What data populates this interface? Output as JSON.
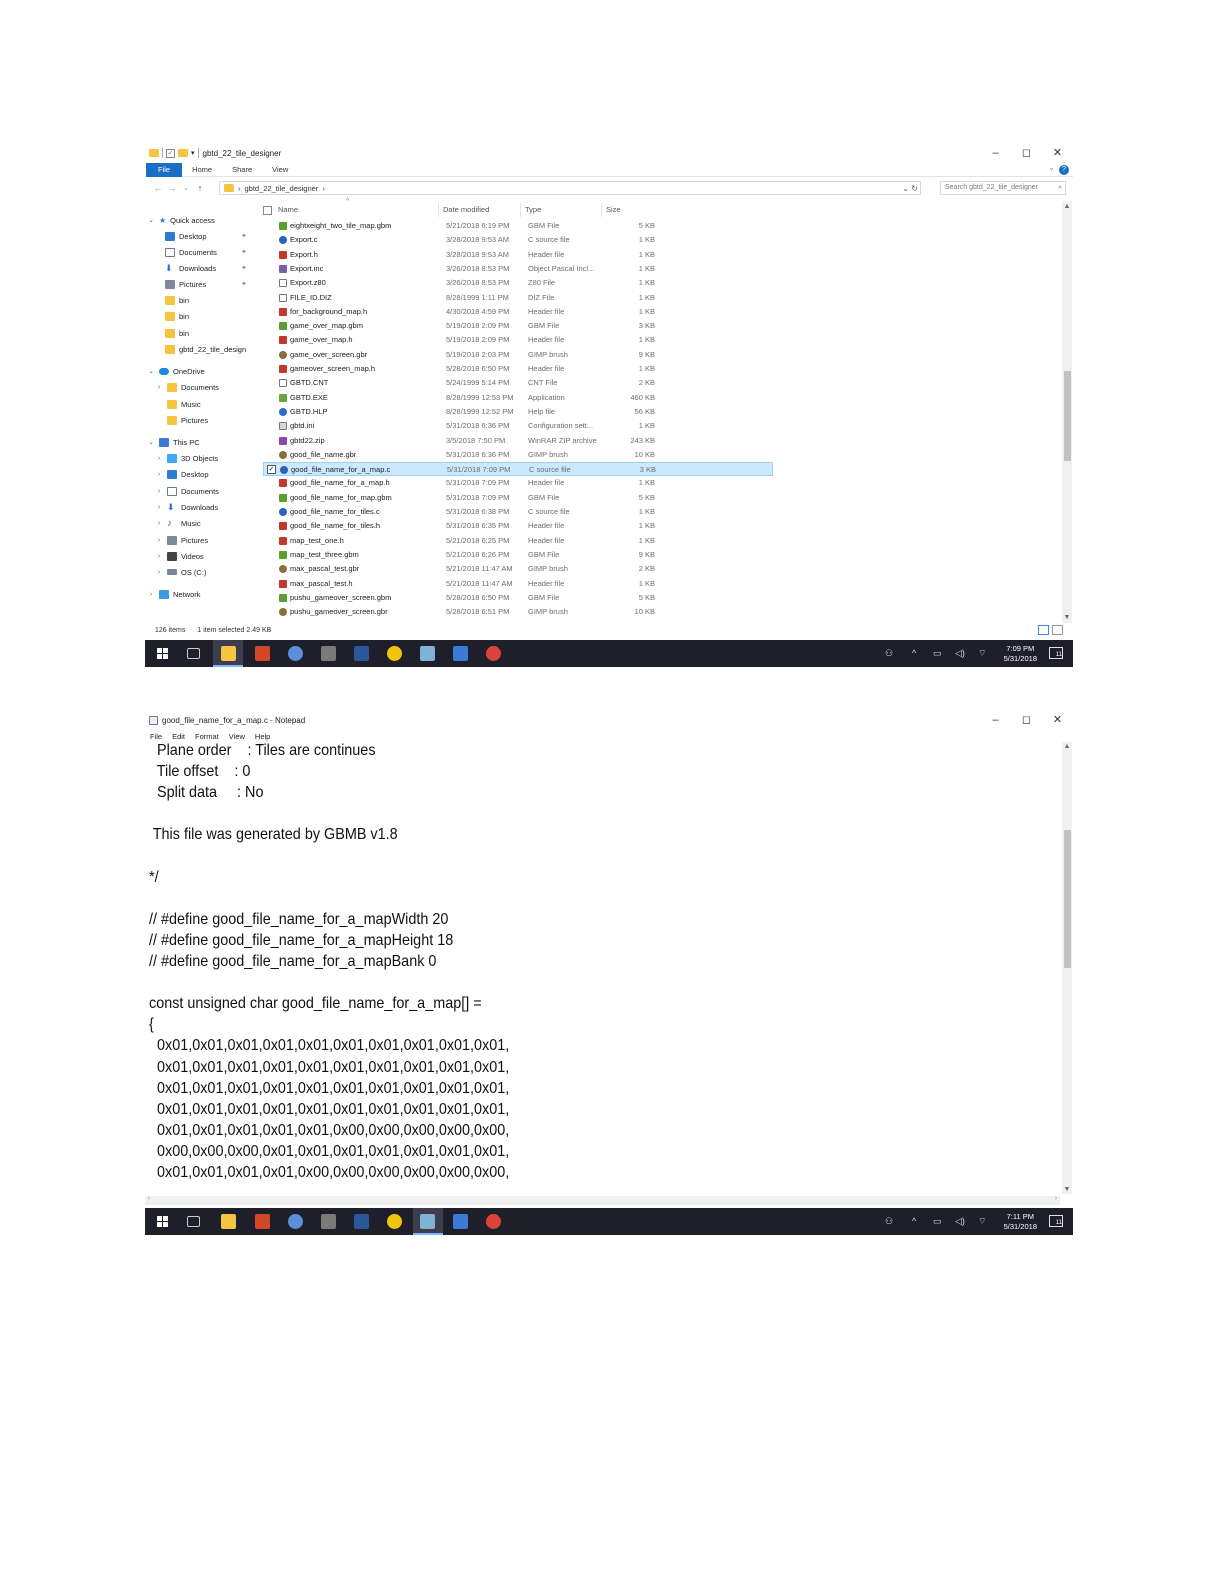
{
  "explorer": {
    "title": "gbtd_22_tile_designer",
    "ribbon_tabs": [
      "File",
      "Home",
      "Share",
      "View"
    ],
    "address_path": "gbtd_22_tile_designer",
    "search_placeholder": "Search gbtd_22_tile_designer",
    "columns": [
      "Name",
      "Date modified",
      "Type",
      "Size"
    ],
    "nav": {
      "quick_access": "Quick access",
      "qa_items": [
        "Desktop",
        "Documents",
        "Downloads",
        "Pictures",
        "bin",
        "bin",
        "bin",
        "gbtd_22_tile_design"
      ],
      "onedrive": "OneDrive",
      "onedrive_items": [
        "Documents",
        "Music",
        "Pictures"
      ],
      "this_pc": "This PC",
      "pc_items": [
        "3D Objects",
        "Desktop",
        "Documents",
        "Downloads",
        "Music",
        "Pictures",
        "Videos",
        "OS (C:)"
      ],
      "network": "Network"
    },
    "files": [
      {
        "name": "eightxeight_two_tile_map.gbm",
        "date": "5/21/2018 6:19 PM",
        "type": "GBM File",
        "size": "5 KB",
        "icon": "gbm"
      },
      {
        "name": "Export.c",
        "date": "3/28/2018 9:53 AM",
        "type": "C source file",
        "size": "1 KB",
        "icon": "c"
      },
      {
        "name": "Export.h",
        "date": "3/28/2018 9:53 AM",
        "type": "Header file",
        "size": "1 KB",
        "icon": "h"
      },
      {
        "name": "Export.inc",
        "date": "3/26/2018 8:53 PM",
        "type": "Object Pascal Incl...",
        "size": "1 KB",
        "icon": "inc"
      },
      {
        "name": "Export.z80",
        "date": "3/26/2018 8:53 PM",
        "type": "Z80 File",
        "size": "1 KB",
        "icon": "plain"
      },
      {
        "name": "FILE_ID.DIZ",
        "date": "8/28/1999 1:11 PM",
        "type": "DIZ File",
        "size": "1 KB",
        "icon": "plain"
      },
      {
        "name": "for_background_map.h",
        "date": "4/30/2018 4:59 PM",
        "type": "Header file",
        "size": "1 KB",
        "icon": "h"
      },
      {
        "name": "game_over_map.gbm",
        "date": "5/19/2018 2:09 PM",
        "type": "GBM File",
        "size": "3 KB",
        "icon": "gbm"
      },
      {
        "name": "game_over_map.h",
        "date": "5/19/2018 2:09 PM",
        "type": "Header file",
        "size": "1 KB",
        "icon": "h"
      },
      {
        "name": "game_over_screen.gbr",
        "date": "5/19/2018 2:03 PM",
        "type": "GIMP brush",
        "size": "9 KB",
        "icon": "gbr"
      },
      {
        "name": "gameover_screen_map.h",
        "date": "5/28/2018 6:50 PM",
        "type": "Header file",
        "size": "1 KB",
        "icon": "h"
      },
      {
        "name": "GBTD.CNT",
        "date": "5/24/1999 5:14 PM",
        "type": "CNT File",
        "size": "2 KB",
        "icon": "plain"
      },
      {
        "name": "GBTD.EXE",
        "date": "8/28/1999 12:53 PM",
        "type": "Application",
        "size": "460 KB",
        "icon": "exe"
      },
      {
        "name": "GBTD.HLP",
        "date": "8/28/1999 12:52 PM",
        "type": "Help file",
        "size": "56 KB",
        "icon": "help"
      },
      {
        "name": "gbtd.ini",
        "date": "5/31/2018 6:36 PM",
        "type": "Configuration sett...",
        "size": "1 KB",
        "icon": "ini"
      },
      {
        "name": "gbtd22.zip",
        "date": "3/5/2018 7:50 PM",
        "type": "WinRAR ZIP archive",
        "size": "243 KB",
        "icon": "zip"
      },
      {
        "name": "good_file_name.gbr",
        "date": "5/31/2018 6:36 PM",
        "type": "GIMP brush",
        "size": "10 KB",
        "icon": "gbr"
      },
      {
        "name": "good_file_name_for_a_map.c",
        "date": "5/31/2018 7:09 PM",
        "type": "C source file",
        "size": "3 KB",
        "icon": "c",
        "selected": true
      },
      {
        "name": "good_file_name_for_a_map.h",
        "date": "5/31/2018 7:09 PM",
        "type": "Header file",
        "size": "1 KB",
        "icon": "h"
      },
      {
        "name": "good_file_name_for_map.gbm",
        "date": "5/31/2018 7:09 PM",
        "type": "GBM File",
        "size": "5 KB",
        "icon": "gbm"
      },
      {
        "name": "good_file_name_for_tiles.c",
        "date": "5/31/2018 6:38 PM",
        "type": "C source file",
        "size": "1 KB",
        "icon": "c"
      },
      {
        "name": "good_file_name_for_tiles.h",
        "date": "5/31/2018 6:35 PM",
        "type": "Header file",
        "size": "1 KB",
        "icon": "h"
      },
      {
        "name": "map_test_one.h",
        "date": "5/21/2018 6:25 PM",
        "type": "Header file",
        "size": "1 KB",
        "icon": "h"
      },
      {
        "name": "map_test_three.gbm",
        "date": "5/21/2018 6:26 PM",
        "type": "GBM File",
        "size": "9 KB",
        "icon": "gbm"
      },
      {
        "name": "max_pascal_test.gbr",
        "date": "5/21/2018 11:47 AM",
        "type": "GIMP brush",
        "size": "2 KB",
        "icon": "gbr"
      },
      {
        "name": "max_pascal_test.h",
        "date": "5/21/2018 11:47 AM",
        "type": "Header file",
        "size": "1 KB",
        "icon": "h"
      },
      {
        "name": "pushu_gameover_screen.gbm",
        "date": "5/28/2018 6:50 PM",
        "type": "GBM File",
        "size": "5 KB",
        "icon": "gbm"
      },
      {
        "name": "pushu_gameover_screen.gbr",
        "date": "5/28/2018 6:51 PM",
        "type": "GIMP brush",
        "size": "10 KB",
        "icon": "gbr"
      }
    ],
    "status_items": "126 items",
    "status_selected": "1 item selected  2.49 KB",
    "clock_time": "7:09 PM",
    "clock_date": "5/31/2018"
  },
  "notepad": {
    "title": "good_file_name_for_a_map.c - Notepad",
    "menu": [
      "File",
      "Edit",
      "Format",
      "View",
      "Help"
    ],
    "lines": [
      "  Plane order    : Tiles are continues",
      "  Tile offset    : 0",
      "  Split data     : No",
      "",
      " This file was generated by GBMB v1.8",
      "",
      "*/",
      "",
      "// #define good_file_name_for_a_mapWidth 20",
      "// #define good_file_name_for_a_mapHeight 18",
      "// #define good_file_name_for_a_mapBank 0",
      "",
      "const unsigned char good_file_name_for_a_map[] =",
      "{",
      "  0x01,0x01,0x01,0x01,0x01,0x01,0x01,0x01,0x01,0x01,",
      "  0x01,0x01,0x01,0x01,0x01,0x01,0x01,0x01,0x01,0x01,",
      "  0x01,0x01,0x01,0x01,0x01,0x01,0x01,0x01,0x01,0x01,",
      "  0x01,0x01,0x01,0x01,0x01,0x01,0x01,0x01,0x01,0x01,",
      "  0x01,0x01,0x01,0x01,0x01,0x00,0x00,0x00,0x00,0x00,",
      "  0x00,0x00,0x00,0x01,0x01,0x01,0x01,0x01,0x01,0x01,",
      "  0x01,0x01,0x01,0x01,0x00,0x00,0x00,0x00,0x00,0x00,"
    ],
    "clock_time": "7:11 PM",
    "clock_date": "5/31/2018"
  },
  "taskbar_icons": [
    "file-explorer-icon",
    "powerpoint-icon",
    "paint-icon",
    "game-icon",
    "word-icon",
    "norton-icon",
    "notepad-icon",
    "photos-icon",
    "chrome-icon"
  ],
  "colors": {
    "accent": "#1a6fc4",
    "selection": "#cce8ff",
    "taskbar": "#1f1f2b"
  }
}
